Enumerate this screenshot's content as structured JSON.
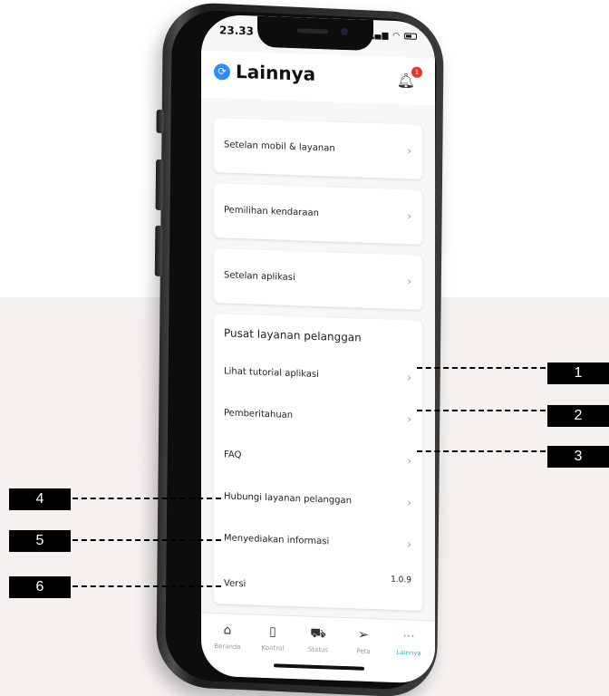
{
  "status_bar": {
    "time": "23.33"
  },
  "header": {
    "title": "Lainnya",
    "notification_count": "1"
  },
  "menu_cards": [
    {
      "label": "Setelan mobil & layanan"
    },
    {
      "label": "Pemilihan kendaraan"
    },
    {
      "label": "Setelan aplikasi"
    }
  ],
  "support": {
    "title": "Pusat layanan pelanggan",
    "items": [
      {
        "label": "Lihat tutorial aplikasi"
      },
      {
        "label": "Pemberitahuan"
      },
      {
        "label": "FAQ"
      },
      {
        "label": "Hubungi layanan pelanggan"
      },
      {
        "label": "Menyediakan informasi"
      }
    ],
    "version_label": "Versi",
    "version_value": "1.0.9"
  },
  "bottom_nav": [
    {
      "label": "Beranda",
      "icon": "home-icon"
    },
    {
      "label": "Kontrol",
      "icon": "remote-icon"
    },
    {
      "label": "Status",
      "icon": "car-icon"
    },
    {
      "label": "Peta",
      "icon": "navigation-icon"
    },
    {
      "label": "Lainnya",
      "icon": "more-icon"
    }
  ],
  "callouts": [
    "1",
    "2",
    "3",
    "4",
    "5",
    "6"
  ]
}
